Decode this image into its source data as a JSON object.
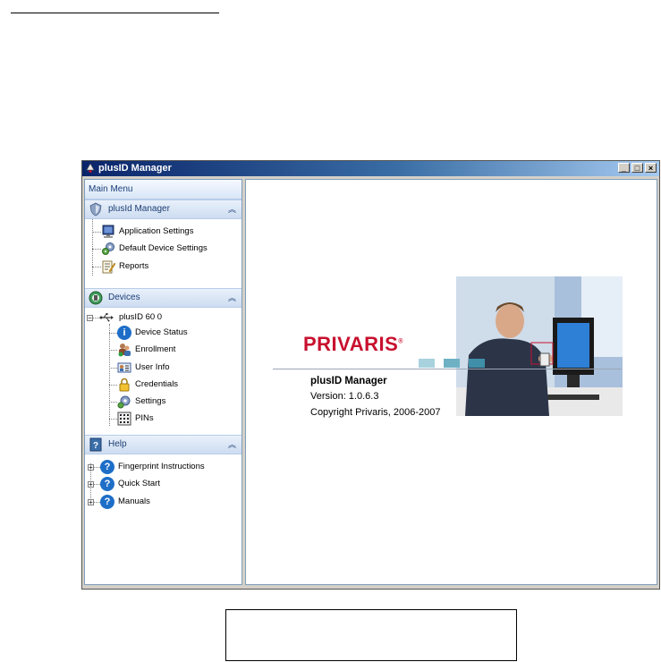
{
  "window": {
    "title": "plusID Manager",
    "controls": {
      "minimize": "_",
      "maximize": "□",
      "close": "×"
    }
  },
  "sidebar": {
    "main_menu_label": "Main Menu",
    "groups": [
      {
        "label": "plusId Manager",
        "icon": "shield-icon",
        "items": [
          {
            "label": "Application Settings",
            "icon": "monitor-icon"
          },
          {
            "label": "Default Device Settings",
            "icon": "gears-icon"
          },
          {
            "label": "Reports",
            "icon": "report-icon"
          }
        ]
      },
      {
        "label": "Devices",
        "icon": "devices-globe-icon",
        "device": {
          "label": "plusID 60 0",
          "icon": "usb-icon"
        },
        "items": [
          {
            "label": "Device Status",
            "icon": "info-icon"
          },
          {
            "label": "Enrollment",
            "icon": "users-icon"
          },
          {
            "label": "User Info",
            "icon": "user-card-icon"
          },
          {
            "label": "Credentials",
            "icon": "lock-icon"
          },
          {
            "label": "Settings",
            "icon": "gear-icon"
          },
          {
            "label": "PINs",
            "icon": "keypad-icon"
          }
        ]
      },
      {
        "label": "Help",
        "icon": "help-book-icon",
        "items": [
          {
            "label": "Fingerprint Instructions",
            "icon": "question-icon"
          },
          {
            "label": "Quick Start",
            "icon": "question-icon"
          },
          {
            "label": "Manuals",
            "icon": "question-icon"
          }
        ]
      }
    ]
  },
  "splash": {
    "logo": "PRIVARIS",
    "logo_mark": "®",
    "product_name": "plusID Manager",
    "version": "Version: 1.0.6.3",
    "copyright": "Copyright Privaris, 2006-2007"
  },
  "colors": {
    "brand_red": "#c8102e",
    "title_bar": "#0a246a",
    "accent_square": "#5fa3b8"
  }
}
